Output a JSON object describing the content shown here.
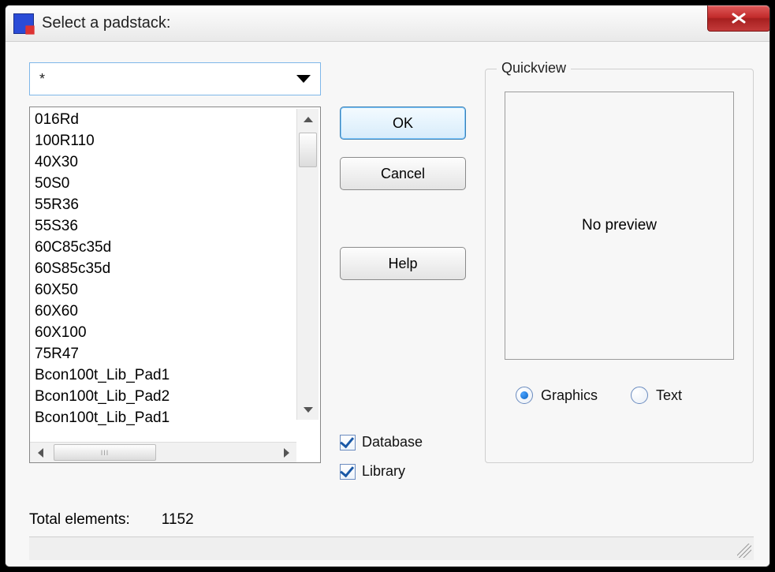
{
  "title": "Select a padstack:",
  "filter": {
    "value": "*"
  },
  "list": {
    "items": [
      "016Rd",
      "100R110",
      "40X30",
      "50S0",
      "55R36",
      "55S36",
      "60C85c35d",
      "60S85c35d",
      "60X50",
      "60X60",
      "60X100",
      "75R47",
      "Bcon100t_Lib_Pad1",
      "Bcon100t_Lib_Pad2",
      "Bcon100t_Lib_Pad1"
    ]
  },
  "buttons": {
    "ok": "OK",
    "cancel": "Cancel",
    "help": "Help"
  },
  "checks": {
    "database": {
      "label": "Database",
      "checked": true
    },
    "library": {
      "label": "Library",
      "checked": true
    }
  },
  "quickview": {
    "legend": "Quickview",
    "preview_text": "No preview",
    "graphics_label": "Graphics",
    "text_label": "Text",
    "mode": "graphics"
  },
  "footer": {
    "total_label": "Total elements:",
    "total_value": "1152"
  },
  "hscroll_hint": "III"
}
